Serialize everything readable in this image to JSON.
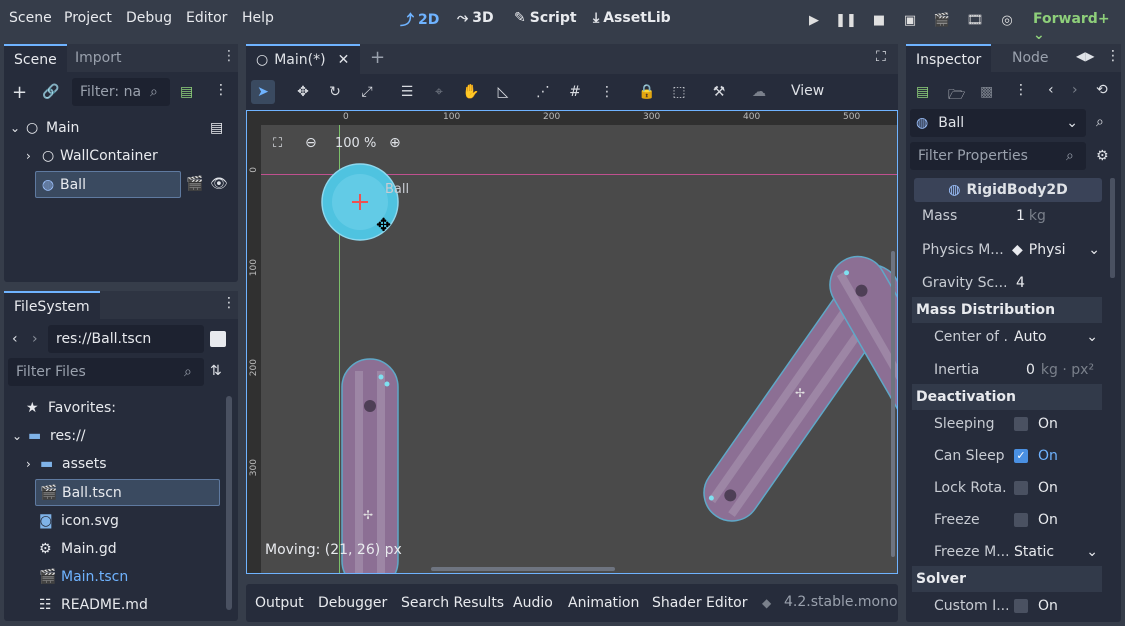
{
  "menubar": {
    "items": [
      "Scene",
      "Project",
      "Debug",
      "Editor",
      "Help"
    ],
    "modes": [
      "2D",
      "3D",
      "Script",
      "AssetLib"
    ],
    "renderer": "Forward+"
  },
  "scene_dock": {
    "tabs": [
      "Scene",
      "Import"
    ],
    "filter_placeholder": "Filter: na",
    "nodes": [
      "Main",
      "WallContainer",
      "Ball"
    ]
  },
  "filesystem_dock": {
    "tab": "FileSystem",
    "path": "res://Ball.tscn",
    "filter_placeholder": "Filter Files",
    "items": [
      "Favorites:",
      "res://",
      "assets",
      "Ball.tscn",
      "icon.svg",
      "Main.gd",
      "Main.tscn",
      "README.md"
    ]
  },
  "editor": {
    "tab_title": "Main(*)",
    "view_label": "View",
    "zoom": "100 %",
    "ruler_top": [
      "0",
      "100",
      "200",
      "300",
      "400",
      "500"
    ],
    "ruler_left": [
      "0",
      "100",
      "200",
      "300"
    ],
    "ball_label": "Ball",
    "status": "Moving: (21, 26) px"
  },
  "bottom_panel": {
    "tabs": [
      "Output",
      "Debugger",
      "Search Results",
      "Audio",
      "Animation",
      "Shader Editor"
    ],
    "version": "4.2.stable.mono"
  },
  "inspector": {
    "tabs": [
      "Inspector",
      "Node"
    ],
    "object_name": "Ball",
    "filter_placeholder": "Filter Properties",
    "class_name": "RigidBody2D",
    "mass_label": "Mass",
    "mass_value": "1",
    "mass_unit": "kg",
    "physics_label": "Physics M...",
    "physics_value": "Physi",
    "gravity_label": "Gravity Sc...",
    "gravity_value": "4",
    "mass_dist_header": "Mass Distribution",
    "center_label": "Center of ...",
    "center_value": "Auto",
    "inertia_label": "Inertia",
    "inertia_value": "0",
    "inertia_unit": "kg · px²",
    "deactivation_header": "Deactivation",
    "sleeping_label": "Sleeping",
    "can_sleep_label": "Can Sleep",
    "lock_rot_label": "Lock Rota...",
    "freeze_label": "Freeze",
    "freeze_mode_label": "Freeze M...",
    "freeze_mode_value": "Static",
    "on_text": "On",
    "solver_header": "Solver",
    "custom_label": "Custom I..."
  },
  "colors": {
    "accent": "#6fb3ff",
    "background": "#363d4a",
    "panel": "#262c3b",
    "viewport": "#4a4a4a",
    "ball": "#4fc3e0",
    "wall": "#8c6f94"
  }
}
